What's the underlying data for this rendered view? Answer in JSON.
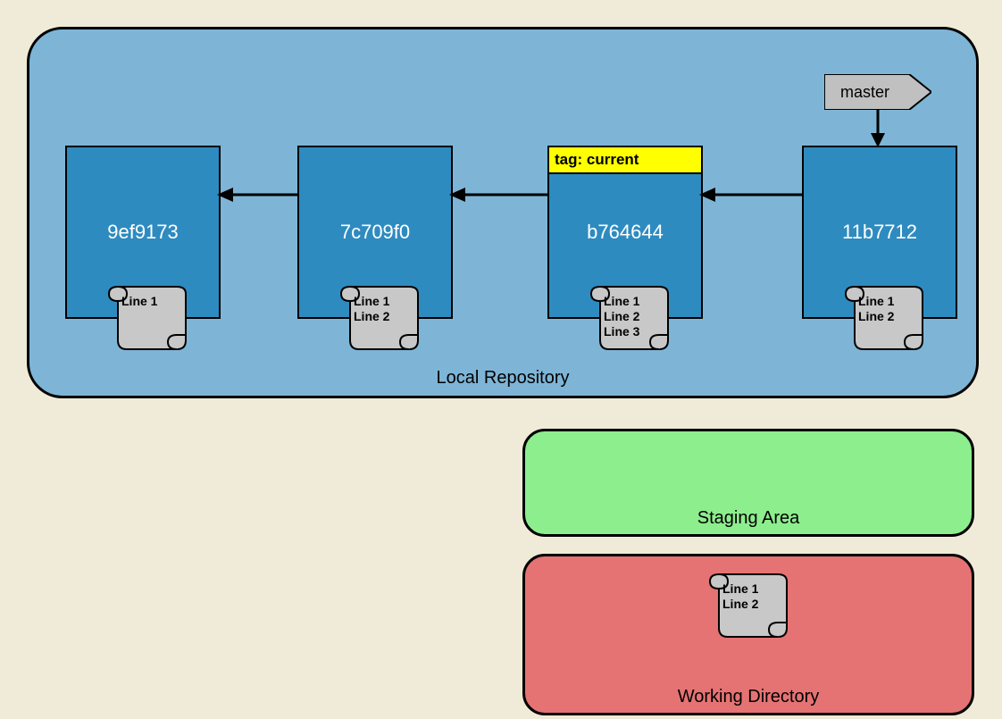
{
  "localRepo": {
    "label": "Local Repository",
    "commits": [
      {
        "hash": "9ef9173",
        "tag": null,
        "file": "Line 1"
      },
      {
        "hash": "7c709f0",
        "tag": null,
        "file": "Line 1\nLine 2"
      },
      {
        "hash": "b764644",
        "tag": "tag: current",
        "file": "Line 1\nLine 2\nLine 3"
      },
      {
        "hash": "11b7712",
        "tag": null,
        "file": "Line 1\nLine 2"
      }
    ],
    "branch": "master"
  },
  "stagingArea": {
    "label": "Staging Area"
  },
  "workingDir": {
    "label": "Working Directory",
    "file": "Line 1\nLine 2"
  }
}
